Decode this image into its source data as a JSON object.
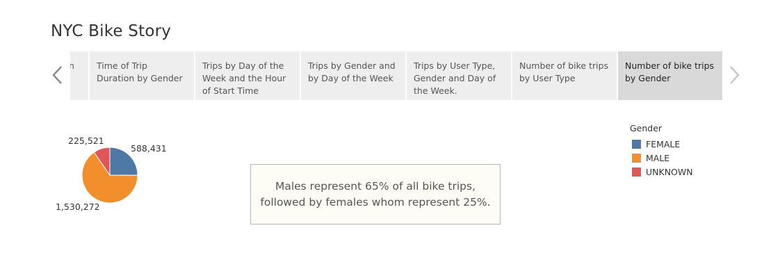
{
  "story": {
    "title": "NYC Bike Story"
  },
  "nav": {
    "prev_icon": "chevron-left-icon",
    "next_icon": "chevron-right-icon"
  },
  "story_points": [
    {
      "label": "n",
      "active": false
    },
    {
      "label": "Time of Trip Duration by Gender",
      "active": false
    },
    {
      "label": "Trips by Day of the Week and the Hour of Start Time",
      "active": false
    },
    {
      "label": "Trips by Gender and by Day of the Week",
      "active": false
    },
    {
      "label": "Trips by User Type, Gender and Day of the Week.",
      "active": false
    },
    {
      "label": "Number of bike trips by User Type",
      "active": false
    },
    {
      "label": "Number of bike trips by Gender",
      "active": true
    }
  ],
  "chart_data": {
    "type": "pie",
    "categories": [
      "FEMALE",
      "MALE",
      "UNKNOWN"
    ],
    "values": [
      588431,
      1530272,
      225521
    ],
    "value_labels": [
      "588,431",
      "1,530,272",
      "225,521"
    ],
    "colors": [
      "#4e79a7",
      "#f28e2b",
      "#e15759"
    ],
    "legend": {
      "title": "Gender",
      "placement": "right"
    }
  },
  "annotation": {
    "text": "Males represent 65% of all bike trips, followed by females whom represent 25%."
  },
  "colors": {
    "active_tab": "#d9d9d9",
    "tab": "#eeeeee",
    "annotation_bg": "#fdfdf5"
  }
}
